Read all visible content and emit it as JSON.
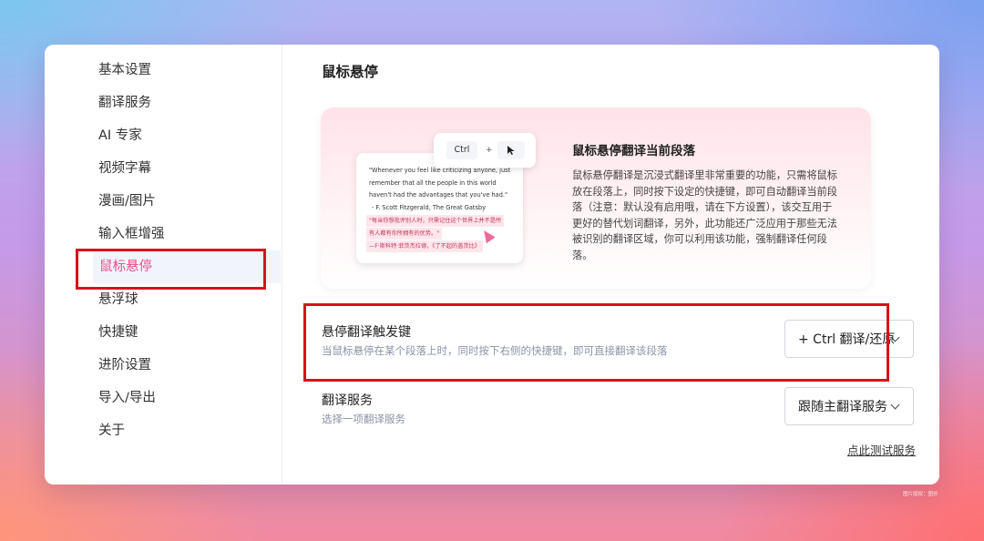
{
  "sidebar": {
    "items": [
      {
        "label": "基本设置"
      },
      {
        "label": "翻译服务"
      },
      {
        "label": "AI 专家"
      },
      {
        "label": "视频字幕"
      },
      {
        "label": "漫画/图片"
      },
      {
        "label": "输入框增强"
      },
      {
        "label": "鼠标悬停"
      },
      {
        "label": "悬浮球"
      },
      {
        "label": "快捷键"
      },
      {
        "label": "进阶设置"
      },
      {
        "label": "导入/导出"
      },
      {
        "label": "关于"
      }
    ],
    "active_index": 6
  },
  "main": {
    "title": "鼠标悬停",
    "hero": {
      "title": "鼠标悬停翻译当前段落",
      "description": "鼠标悬停翻译是沉浸式翻译里非常重要的功能，只需将鼠标放在段落上，同时按下设定的快捷键，即可自动翻译当前段落（注意：默认没有启用哦，请在下方设置），该交互用于更好的替代划词翻译，另外，此功能还广泛应用于那些无法被识别的翻译区域，你可以利用该功能，强制翻译任何段落。",
      "demo": {
        "key_label": "Ctrl",
        "plus": "+",
        "english_quote": "\"Whenever you feel like criticizing anyone, just remember that all the people in this world haven't had the advantages that you've had.\"",
        "english_source": "- F. Scott Fitzgerald, The Great Gatsby",
        "chinese_quote_1": "\"每当你想批评别人时，只需记住这个世界上并不是所",
        "chinese_quote_2": "有人都有你所拥有的优势。\"",
        "chinese_source": "—F·斯科特·菲茨杰拉德，《了不起的盖茨比》"
      }
    },
    "settings": [
      {
        "title": "悬停翻译触发键",
        "description": "当鼠标悬停在某个段落上时，同时按下右侧的快捷键，即可直接翻译该段落",
        "value": "+ Ctrl 翻译/还原"
      },
      {
        "title": "翻译服务",
        "description": "选择一项翻译服务",
        "value": "跟随主翻译服务"
      }
    ],
    "test_link": "点此测试服务"
  },
  "footer_credit": "图片版权：图珍",
  "colors": {
    "accent": "#ea4c89",
    "highlight": "#d8121c"
  }
}
